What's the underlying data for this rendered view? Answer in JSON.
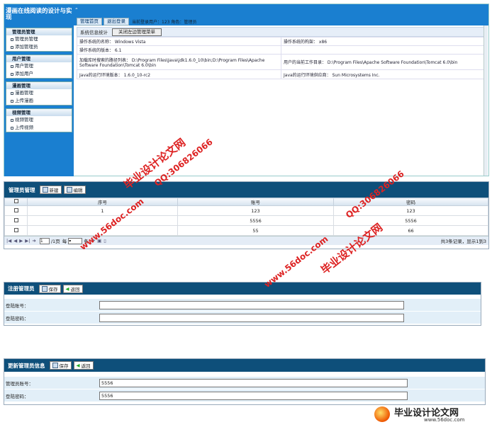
{
  "app": {
    "title": "漫画在线阅读的设计与实现",
    "quote": "“",
    "tabs": [
      "管理首页",
      "退出登录"
    ],
    "user_info": "当前登录用户：123 角色：管理员"
  },
  "sidebar": {
    "groups": [
      {
        "title": "管理员管理",
        "items": [
          "管理员管理",
          "添加管理员"
        ]
      },
      {
        "title": "用户管理",
        "items": [
          "用户管理",
          "添加用户"
        ]
      },
      {
        "title": "漫画管理",
        "items": [
          "漫画管理",
          "上传漫画"
        ]
      },
      {
        "title": "视频管理",
        "items": [
          "视频管理",
          "上传视频"
        ]
      }
    ]
  },
  "stats": {
    "title": "系统信息统计",
    "close_button": "关闭左边管理菜单",
    "rows": [
      [
        "操作系统的名称：  Windows Vista",
        "操作系统的构架：  x86"
      ],
      [
        "操作系统的版本：  6.1",
        ""
      ],
      [
        "加载库时搜索的路径列表：  D:\\Program Files\\Java\\jdk1.6.0_10\\bin;D:\\Program Files\\Apache Software Foundation\\Tomcat 6.0\\bin",
        "用户的当前工作目录：  D:\\Program Files\\Apache Software Foundation\\Tomcat 6.0\\bin"
      ],
      [
        "Java的运行环境版本：  1.6.0_10-rc2",
        "Java的运行环境供应商：  Sun Microsystems Inc."
      ]
    ]
  },
  "admin_list": {
    "title": "管理员管理",
    "buttons": {
      "new": "新建",
      "edit": "编辑"
    },
    "columns": [
      "序号",
      "账号",
      "密码"
    ],
    "rows": [
      [
        "1",
        "123",
        "123"
      ],
      [
        "",
        "5556",
        "5556"
      ],
      [
        "",
        "55",
        "66"
      ]
    ],
    "pager": {
      "page": "1",
      "of": "/1页",
      "per_label": "每",
      "per_suffix": "条",
      "summary": "共3条记录，显示1到3"
    }
  },
  "register": {
    "title": "注册管理员",
    "save": "保存",
    "back": "返回",
    "fields": [
      {
        "label": "登陆账号：",
        "value": ""
      },
      {
        "label": "登陆密码：",
        "value": ""
      }
    ]
  },
  "update": {
    "title": "更新管理员信息",
    "save": "保存",
    "back": "返回",
    "fields": [
      {
        "label": "管理员账号：",
        "value": "5556"
      },
      {
        "label": "登陆密码：",
        "value": "5556"
      }
    ]
  },
  "watermarks": {
    "site": "www.56doc.com",
    "qq": "QQ:306826066",
    "brand": "毕业设计论文网",
    "logo_text": "毕业设计论文网",
    "logo_url": "www.56doc.com"
  }
}
